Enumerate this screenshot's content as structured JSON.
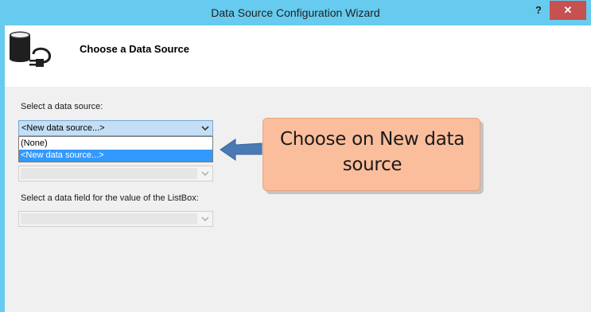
{
  "window": {
    "title": "Data Source Configuration Wizard",
    "help_label": "?",
    "close_label": "✕"
  },
  "header": {
    "title": "Choose a Data Source",
    "icon": "database-plug-icon"
  },
  "form": {
    "select_source_label": "Select a data source:",
    "select_source_value": "<New data source...>",
    "dropdown_options": [
      "(None)",
      "<New data source...>"
    ],
    "dropdown_selected_index": 1,
    "select_value_field_label": "Select a data field for the value of the ListBox:"
  },
  "callout": {
    "line1": "Choose on New data",
    "line2": "source"
  },
  "colors": {
    "titlebar": "#67cbef",
    "close": "#c75050",
    "callout": "#fbbe9c",
    "arrow": "#4a7ab5",
    "selection": "#3399ff"
  }
}
